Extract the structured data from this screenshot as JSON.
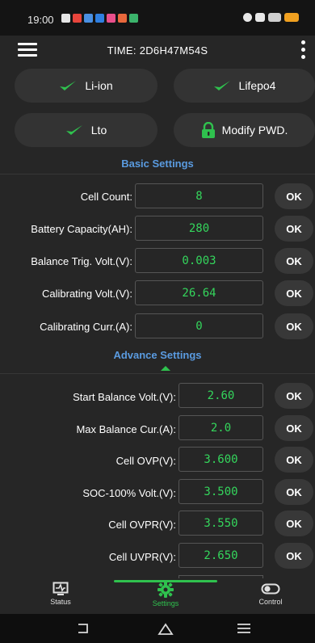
{
  "status_bar": {
    "time": "19:00",
    "notification_icons": [
      {
        "name": "photo-icon",
        "color": "#e6e6e6"
      },
      {
        "name": "app-red-icon",
        "color": "#e8453c"
      },
      {
        "name": "app-blue-icon",
        "color": "#4a90e2"
      },
      {
        "name": "app-blue2-icon",
        "color": "#2f7fe0"
      },
      {
        "name": "app-pink-icon",
        "color": "#e94f8b"
      },
      {
        "name": "app-orange-icon",
        "color": "#e8683c"
      },
      {
        "name": "app-green-icon",
        "color": "#3bb36b"
      }
    ]
  },
  "header": {
    "title": "TIME: 2D6H47M54S"
  },
  "battery_types": {
    "liion": "Li-ion",
    "lifepo4": "Lifepo4",
    "lto": "Lto",
    "modify_pwd": "Modify PWD."
  },
  "basic": {
    "title": "Basic Settings",
    "rows": [
      {
        "label": "Cell Count:",
        "value": "8",
        "ok": "OK"
      },
      {
        "label": "Battery Capacity(AH):",
        "value": "280",
        "ok": "OK"
      },
      {
        "label": "Balance Trig. Volt.(V):",
        "value": "0.003",
        "ok": "OK"
      },
      {
        "label": "Calibrating Volt.(V):",
        "value": "26.64",
        "ok": "OK"
      },
      {
        "label": "Calibrating Curr.(A):",
        "value": "0",
        "ok": "OK"
      }
    ]
  },
  "advance": {
    "title": "Advance Settings",
    "rows": [
      {
        "label": "Start Balance Volt.(V):",
        "value": "2.60",
        "ok": "OK"
      },
      {
        "label": "Max Balance Cur.(A):",
        "value": "2.0",
        "ok": "OK"
      },
      {
        "label": "Cell OVP(V):",
        "value": "3.600",
        "ok": "OK"
      },
      {
        "label": "SOC-100% Volt.(V):",
        "value": "3.500",
        "ok": "OK"
      },
      {
        "label": "Cell OVPR(V):",
        "value": "3.550",
        "ok": "OK"
      },
      {
        "label": "Cell UVPR(V):",
        "value": "2.650",
        "ok": "OK"
      }
    ]
  },
  "bottom_nav": {
    "status": "Status",
    "settings": "Settings",
    "control": "Control",
    "active": "settings"
  },
  "colors": {
    "background": "#262626",
    "accent_blue": "#5a9be0",
    "value_green": "#34d65c",
    "active_nav_green": "#2fc14e",
    "button_bg": "#333333"
  }
}
